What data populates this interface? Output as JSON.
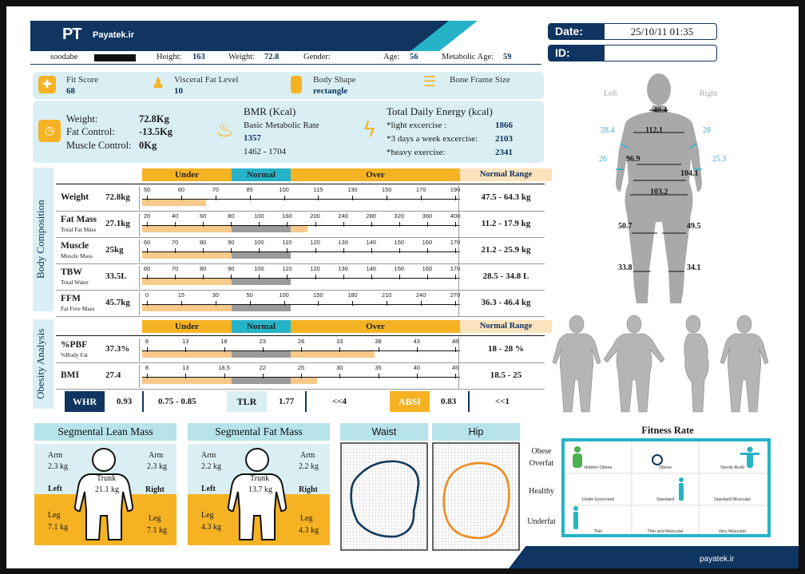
{
  "header": {
    "logo": "PT",
    "brand": "Payatek.ir"
  },
  "patient": {
    "name": "soodabe",
    "height_label": "Height:",
    "height": "163",
    "weight_label": "Weight:",
    "weight": "72.8",
    "gender_label": "Gender:",
    "gender": "",
    "age_label": "Age:",
    "age": "56",
    "metabolic_age_label": "Metabolic Age:",
    "metabolic_age": "59"
  },
  "date": {
    "label": "Date:",
    "value": "25/10/11 01:35"
  },
  "id": {
    "label": "ID:",
    "value": ""
  },
  "summary": {
    "fit_score_label": "Fit Score",
    "fit_score": "68",
    "visceral_label": "Visceral Fat Level",
    "visceral": "10",
    "body_shape_label": "Body Shape",
    "body_shape": "rectangle",
    "bone_frame_label": "Bone Frame Size",
    "bone_frame": ""
  },
  "weight_block": {
    "weight_label": "Weight:",
    "weight": "72.8Kg",
    "fat_control_label": "Fat Control:",
    "fat_control": "-13.5Kg",
    "muscle_control_label": "Muscle Control:",
    "muscle_control": "0Kg"
  },
  "bmr": {
    "title": "BMR (Kcal)",
    "subtitle": "Basic Metabolic Rate",
    "value": "1357",
    "range": "1462 - 1704"
  },
  "energy": {
    "title": "Total Daily Energy (kcal)",
    "rows": [
      {
        "label": "*light excercise :",
        "value": "1866"
      },
      {
        "label": "*3 days a week excercise:",
        "value": "2103"
      },
      {
        "label": "*heavy exercise:",
        "value": "2341"
      }
    ]
  },
  "body_composition": {
    "section_label": "Body Composition",
    "scale_labels": {
      "under": "Under",
      "normal": "Normal",
      "over": "Over",
      "normal_range": "Normal Range"
    },
    "rows": [
      {
        "name": "Weight",
        "sub": "",
        "value": "72.8kg",
        "ticks": [
          "50",
          "60",
          "70",
          "85",
          "100",
          "115",
          "130",
          "150",
          "170",
          "190"
        ],
        "fill": 0.2,
        "range": "47.5 - 64.3 kg"
      },
      {
        "name": "Fat Mass",
        "sub": "Total Fat Mass",
        "value": "27.1kg",
        "ticks": [
          "20",
          "40",
          "60",
          "80",
          "100",
          "160",
          "200",
          "240",
          "280",
          "320",
          "360",
          "400"
        ],
        "fill": 0.52,
        "range": "11.2 - 17.9 kg"
      },
      {
        "name": "Muscle",
        "sub": "Muscle Mass",
        "value": "25kg",
        "ticks": [
          "60",
          "70",
          "80",
          "90",
          "100",
          "110",
          "120",
          "130",
          "140",
          "150",
          "160",
          "170"
        ],
        "fill": 0.3,
        "range": "21.2 - 25.9 kg"
      },
      {
        "name": "TBW",
        "sub": "Total Water",
        "value": "33.5L",
        "ticks": [
          "60",
          "70",
          "80",
          "90",
          "100",
          "110",
          "120",
          "130",
          "140",
          "150",
          "160",
          "170"
        ],
        "fill": 0.36,
        "range": "28.5 - 34.8 L"
      },
      {
        "name": "FFM",
        "sub": "Fat Free Mass",
        "value": "45.7kg",
        "ticks": [
          "0",
          "15",
          "30",
          "50",
          "100",
          "150",
          "180",
          "210",
          "240",
          "270"
        ],
        "fill": 0.33,
        "range": "36.3 - 46.4 kg"
      }
    ]
  },
  "obesity": {
    "section_label": "Obesity Analysis",
    "rows": [
      {
        "name": "%PBF",
        "sub": "%Body Fat",
        "value": "37.3%",
        "ticks": [
          "8",
          "13",
          "18",
          "23",
          "28",
          "33",
          "38",
          "43",
          "48"
        ],
        "fill": 0.73,
        "range": "18 - 28 %"
      },
      {
        "name": "BMI",
        "sub": "",
        "value": "27.4",
        "ticks": [
          "8",
          "13",
          "18.5",
          "22",
          "25",
          "30",
          "35",
          "40",
          "45"
        ],
        "fill": 0.55,
        "range": "18.5 - 25"
      }
    ]
  },
  "indices": {
    "whr_label": "WHR",
    "whr": "0.93",
    "whr_range": "0.75 - 0.85",
    "tlr_label": "TLR",
    "tlr": "1.77",
    "tlr_range": "<<4",
    "absi_label": "ABSI",
    "absi": "0.83",
    "absi_range": "<<1"
  },
  "lean": {
    "title": "Segmental Lean Mass",
    "arm_l_label": "Arm",
    "arm_l": "2.3 kg",
    "arm_r_label": "Arm",
    "arm_r": "2.3 kg",
    "trunk_label": "Trunk",
    "trunk": "21.1 kg",
    "left": "Left",
    "right": "Right",
    "leg_l_label": "Leg",
    "leg_l": "7.1 kg",
    "leg_r_label": "Leg",
    "leg_r": "7.1 kg"
  },
  "fat": {
    "title": "Segmental Fat Mass",
    "arm_l_label": "Arm",
    "arm_l": "2.2 kg",
    "arm_r_label": "Arm",
    "arm_r": "2.2 kg",
    "trunk_label": "Trunk",
    "trunk": "13.7 kg",
    "left": "Left",
    "right": "Right",
    "leg_l_label": "Leg",
    "leg_l": "4.3 kg",
    "leg_r_label": "Leg",
    "leg_r": "4.3 kg"
  },
  "shapes": {
    "waist": "Waist",
    "hip": "Hip"
  },
  "body_map": {
    "left": "Left",
    "right": "Right",
    "neck": "40.4",
    "chest": "112.1",
    "arm_l": "28.4",
    "arm_r": "28",
    "forearm_l": "26",
    "forearm_r": "25.3",
    "waist": "96.9",
    "abdomen": "104.1",
    "hip": "103.2",
    "thigh_l": "50.7",
    "thigh_r": "49.5",
    "calf_l": "33.8",
    "calf_r": "34.1"
  },
  "fitness": {
    "title": "Fitness Rate",
    "rows": [
      "Obese\nOverfat",
      "Healthy",
      "Underfat"
    ],
    "cells": [
      "Hidden Obese",
      "Obese",
      "Sturdy-Build",
      "Under Exercised",
      "Standard",
      "Standard Muscular",
      "Thin",
      "Thin and Muscular",
      "Very Muscular"
    ]
  },
  "footer": {
    "site": "payatek.ir"
  },
  "colors": {
    "navy": "#0f3560",
    "teal": "#27b3c7",
    "orange": "#f5b324",
    "light": "#d9eff3"
  }
}
